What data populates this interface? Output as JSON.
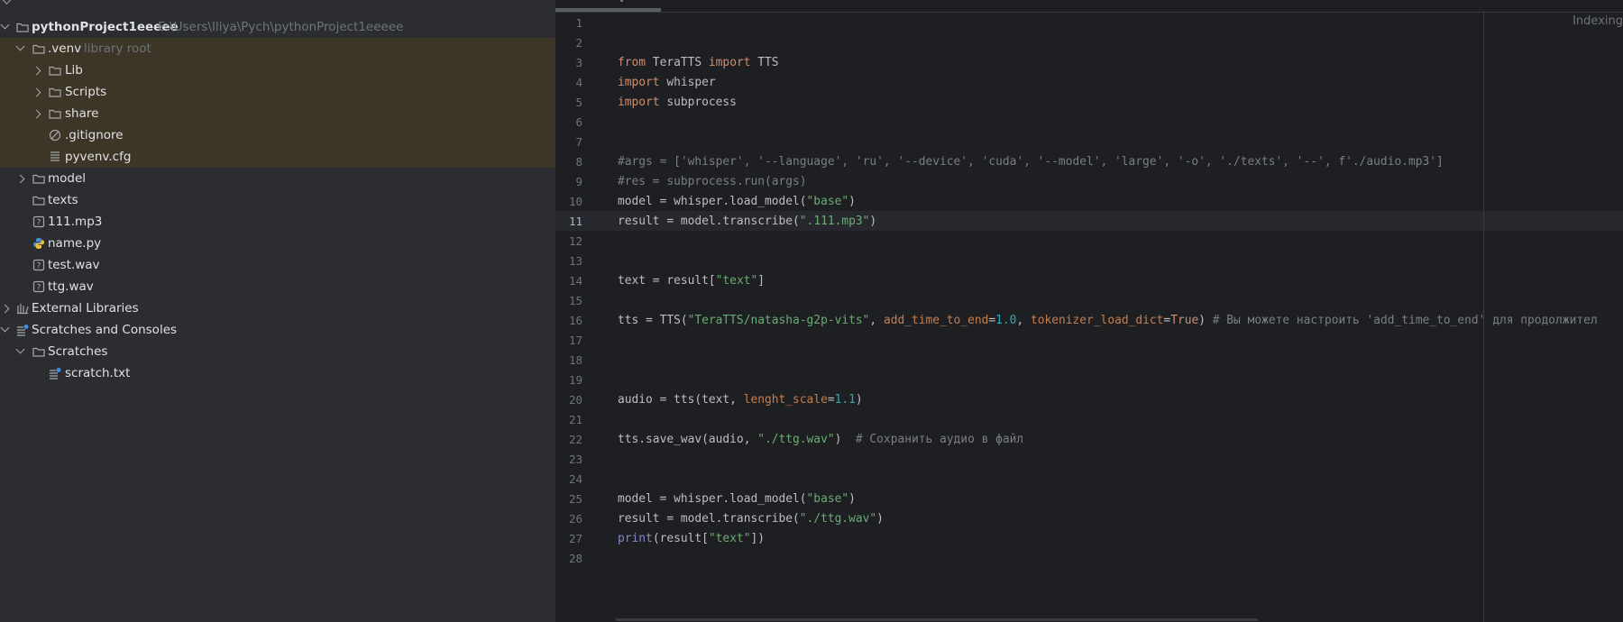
{
  "project_tree": {
    "root": {
      "name": "pythonProject1eeeee",
      "path": "E:\\Users\\Iliya\\Pych\\pythonProject1eeeee"
    },
    "venv": {
      "name": ".venv",
      "hint": "library root"
    },
    "venv_children": [
      "Lib",
      "Scripts",
      "share"
    ],
    "venv_files": [
      ".gitignore",
      "pyvenv.cfg"
    ],
    "root_folders": [
      "model",
      "texts"
    ],
    "root_files": [
      "111.mp3",
      "name.py",
      "test.wav",
      "ttg.wav"
    ],
    "external_libraries": "External Libraries",
    "scratches_and_consoles": "Scratches and Consoles",
    "scratches": "Scratches",
    "scratch_file": "scratch.txt"
  },
  "editor": {
    "status": "Indexing",
    "current_line": 11,
    "line_numbers": [
      "1",
      "2",
      "3",
      "4",
      "5",
      "6",
      "7",
      "8",
      "9",
      "10",
      "11",
      "12",
      "13",
      "14",
      "15",
      "16",
      "17",
      "18",
      "19",
      "20",
      "21",
      "22",
      "23",
      "24",
      "25",
      "26",
      "27",
      "28"
    ],
    "lines": {
      "l3": [
        "from",
        " TeraTTS ",
        "import",
        " TTS"
      ],
      "l4": [
        "import",
        " whisper"
      ],
      "l5": [
        "import",
        " subprocess"
      ],
      "l8": "#args = ['whisper', '--language', 'ru', '--device', 'cuda', '--model', 'large', '-o', './texts', '--', f'./audio.mp3']",
      "l9": "#res = subprocess.run(args)",
      "l10": [
        "model = whisper.load_model(",
        "\"base\"",
        ")"
      ],
      "l11": [
        "result = model.transcribe(",
        "\".111.mp3\"",
        ")"
      ],
      "l14": [
        "text = result[",
        "\"text\"",
        "]"
      ],
      "l16": [
        "tts = TTS(",
        "\"TeraTTS/natasha-g2p-vits\"",
        ", ",
        "add_time_to_end",
        "=",
        "1.0",
        ", ",
        "tokenizer_load_dict",
        "=",
        "True",
        ") ",
        "# Вы можете настроить 'add_time_to_end' для продолжител"
      ],
      "l20": [
        "audio = tts(text, ",
        "lenght_scale",
        "=",
        "1.1",
        ")"
      ],
      "l22": [
        "tts.save_wav(audio, ",
        "\"./ttg.wav\"",
        ")  ",
        "# Сохранить аудио в файл"
      ],
      "l25": [
        "model = whisper.load_model(",
        "\"base\"",
        ")"
      ],
      "l26": [
        "result = model.transcribe(",
        "\"./ttg.wav\"",
        ")"
      ],
      "l27": [
        "print",
        "(result[",
        "\"text\"",
        "])"
      ]
    }
  },
  "colors": {
    "keyword": "#cf8e6d",
    "string": "#6aab73",
    "number": "#2aacb8",
    "named_param": "#c77d4d",
    "comment": "#7a7e85",
    "builtin": "#8888c6",
    "venv_highlight": "#3d3526"
  },
  "icons": [
    "folder-icon",
    "chevron-right-icon",
    "chevron-down-icon",
    "ignore-file-icon",
    "config-file-icon",
    "unknown-file-icon",
    "python-file-icon",
    "libraries-icon",
    "scratches-icon",
    "text-file-icon"
  ]
}
